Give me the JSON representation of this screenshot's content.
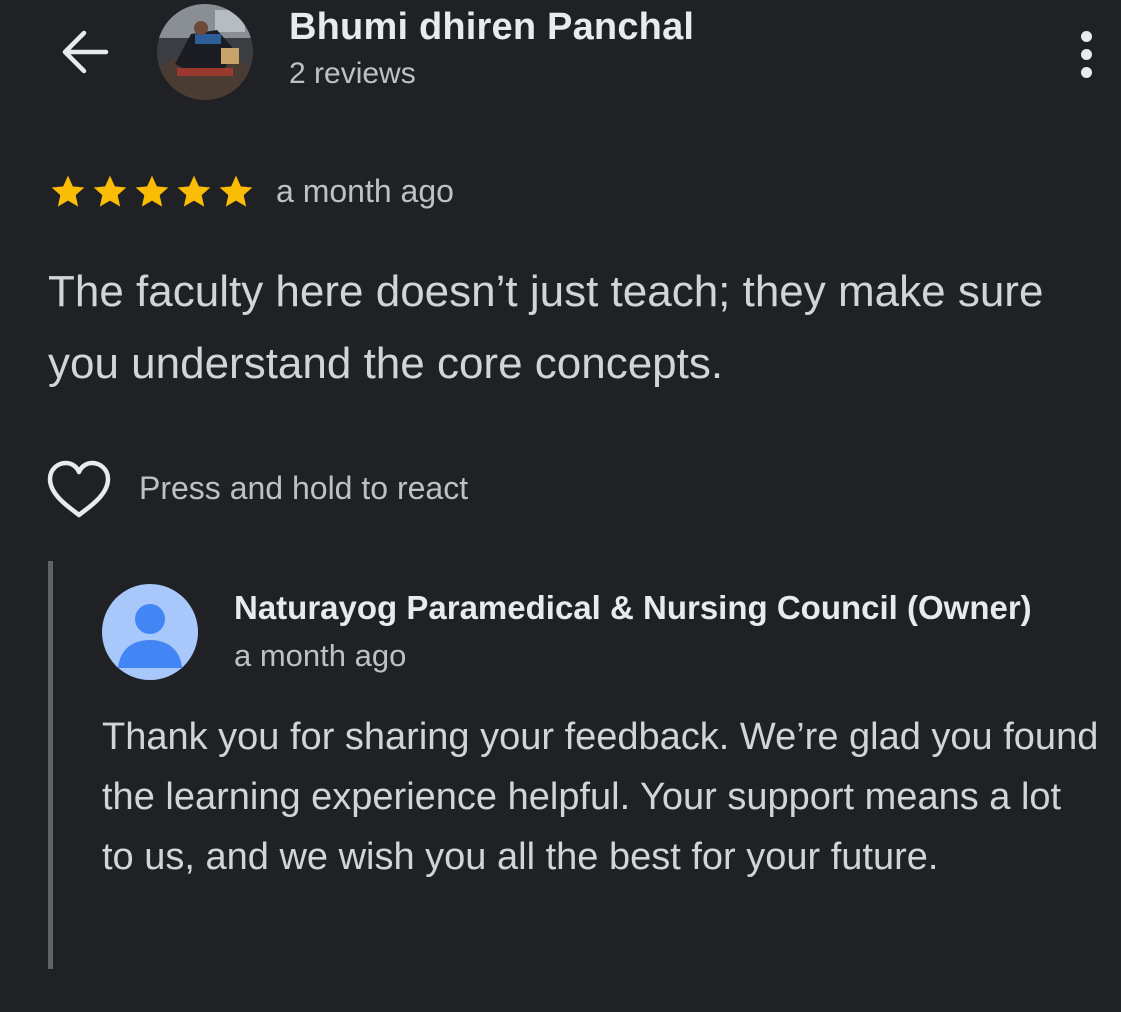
{
  "header": {
    "reviewer_name": "Bhumi dhiren Panchal",
    "review_count": "2 reviews",
    "back_icon": "arrow-back-icon",
    "more_icon": "more-vert-icon"
  },
  "review": {
    "rating": 5,
    "rating_max": 5,
    "star_color": "#fbbc04",
    "date": "a month ago",
    "text": "The faculty here doesn’t just teach; they make sure you understand the core concepts."
  },
  "reaction": {
    "label": "Press and hold to react",
    "icon": "heart-outline-icon"
  },
  "owner_reply": {
    "name": "Naturayog Paramedical & Nursing Council (Owner)",
    "date": "a month ago",
    "text": "Thank you for sharing your feedback. We’re glad you found the learning experience helpful. Your support means a lot to us, and we wish you all the best for your future.",
    "avatar_color": "#a8c7fa",
    "avatar_figure_color": "#4285f4"
  },
  "colors": {
    "background": "#202124",
    "primary_text": "#e8eaed",
    "secondary_text": "#bdc1c6"
  }
}
